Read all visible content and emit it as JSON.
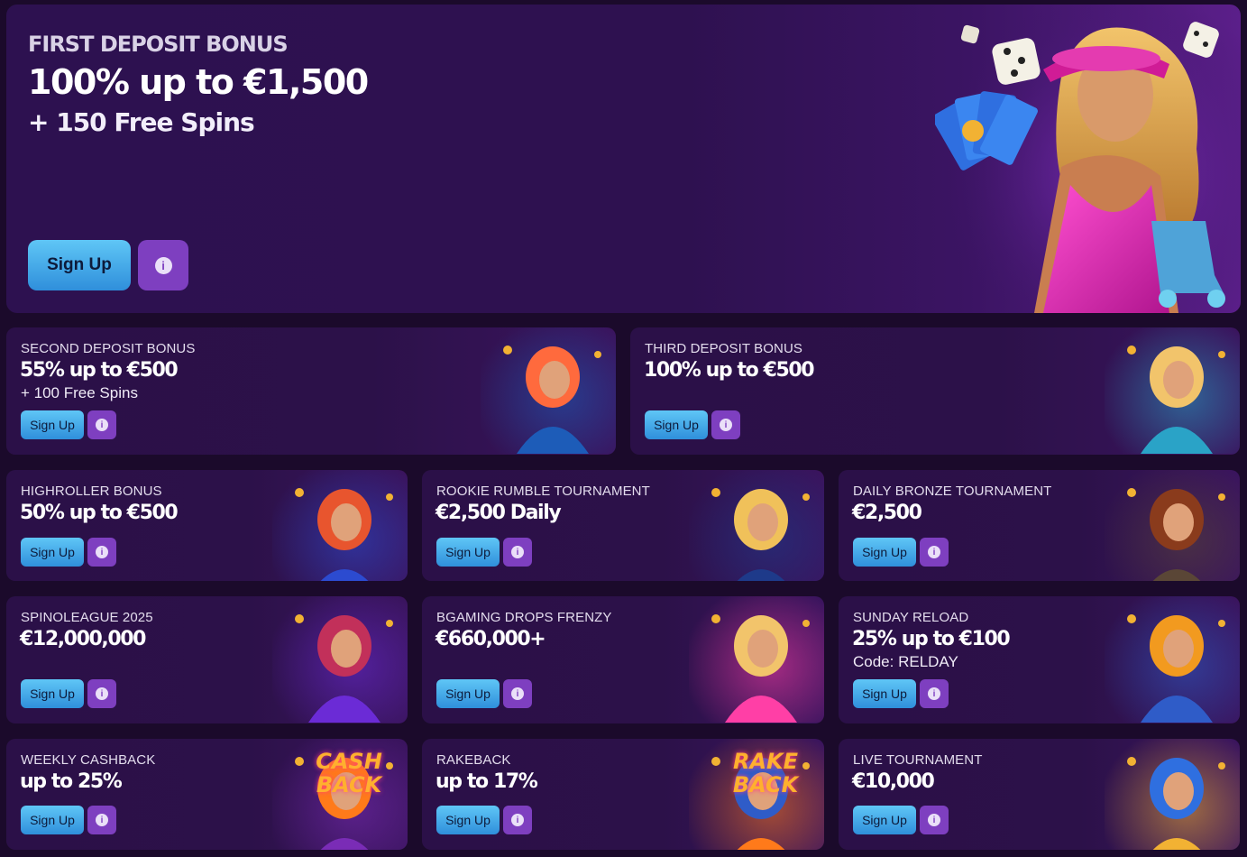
{
  "hero": {
    "kicker": "FIRST DEPOSIT BONUS",
    "headline": "100% up to €1,500",
    "sub": "+ 150 Free Spins",
    "sign_up": "Sign Up",
    "info": "i"
  },
  "cards": [
    {
      "title": "SECOND DEPOSIT BONUS",
      "value": "55% up to €500",
      "extra": "+ 100 Free Spins",
      "sign_up": "Sign Up",
      "info": "i",
      "art": "slot-machine-girl"
    },
    {
      "title": "THIRD DEPOSIT BONUS",
      "value": "100% up to €500",
      "extra": "",
      "sign_up": "Sign Up",
      "info": "i",
      "art": "camera-girl"
    },
    {
      "title": "HIGHROLLER BONUS",
      "value": "50% up to €500",
      "extra": "",
      "sign_up": "Sign Up",
      "info": "i",
      "art": "cards-girl"
    },
    {
      "title": "ROOKIE RUMBLE TOURNAMENT",
      "value": "€2,500 Daily",
      "extra": "",
      "sign_up": "Sign Up",
      "info": "i",
      "art": "trophy-girl"
    },
    {
      "title": "DAILY BRONZE TOURNAMENT",
      "value": "€2,500",
      "extra": "",
      "sign_up": "Sign Up",
      "info": "i",
      "art": "warrior-girl"
    },
    {
      "title": "SPINOLEAGUE 2025",
      "value": "€12,000,000",
      "extra": "",
      "sign_up": "Sign Up",
      "info": "i",
      "art": "league-girl"
    },
    {
      "title": "BGAMING DROPS FRENZY",
      "value": "€660,000+",
      "extra": "",
      "sign_up": "Sign Up",
      "info": "i",
      "art": "clock-girl"
    },
    {
      "title": "SUNDAY RELOAD",
      "value": "25% up to €100",
      "extra": "Code: RELDAY",
      "sign_up": "Sign Up",
      "info": "i",
      "art": "gramophone"
    },
    {
      "title": "WEEKLY CASHBACK",
      "value": "up to 25%",
      "extra": "",
      "sign_up": "Sign Up",
      "info": "i",
      "art": "cashback-car",
      "art_text": "CASH BACK"
    },
    {
      "title": "RAKEBACK",
      "value": "up to 17%",
      "extra": "",
      "sign_up": "Sign Up",
      "info": "i",
      "art": "rakeback-tape",
      "art_text": "RAKE BACK"
    },
    {
      "title": "LIVE TOURNAMENT",
      "value": "€10,000",
      "extra": "",
      "sign_up": "Sign Up",
      "info": "i",
      "art": "roulette-wheel"
    }
  ]
}
